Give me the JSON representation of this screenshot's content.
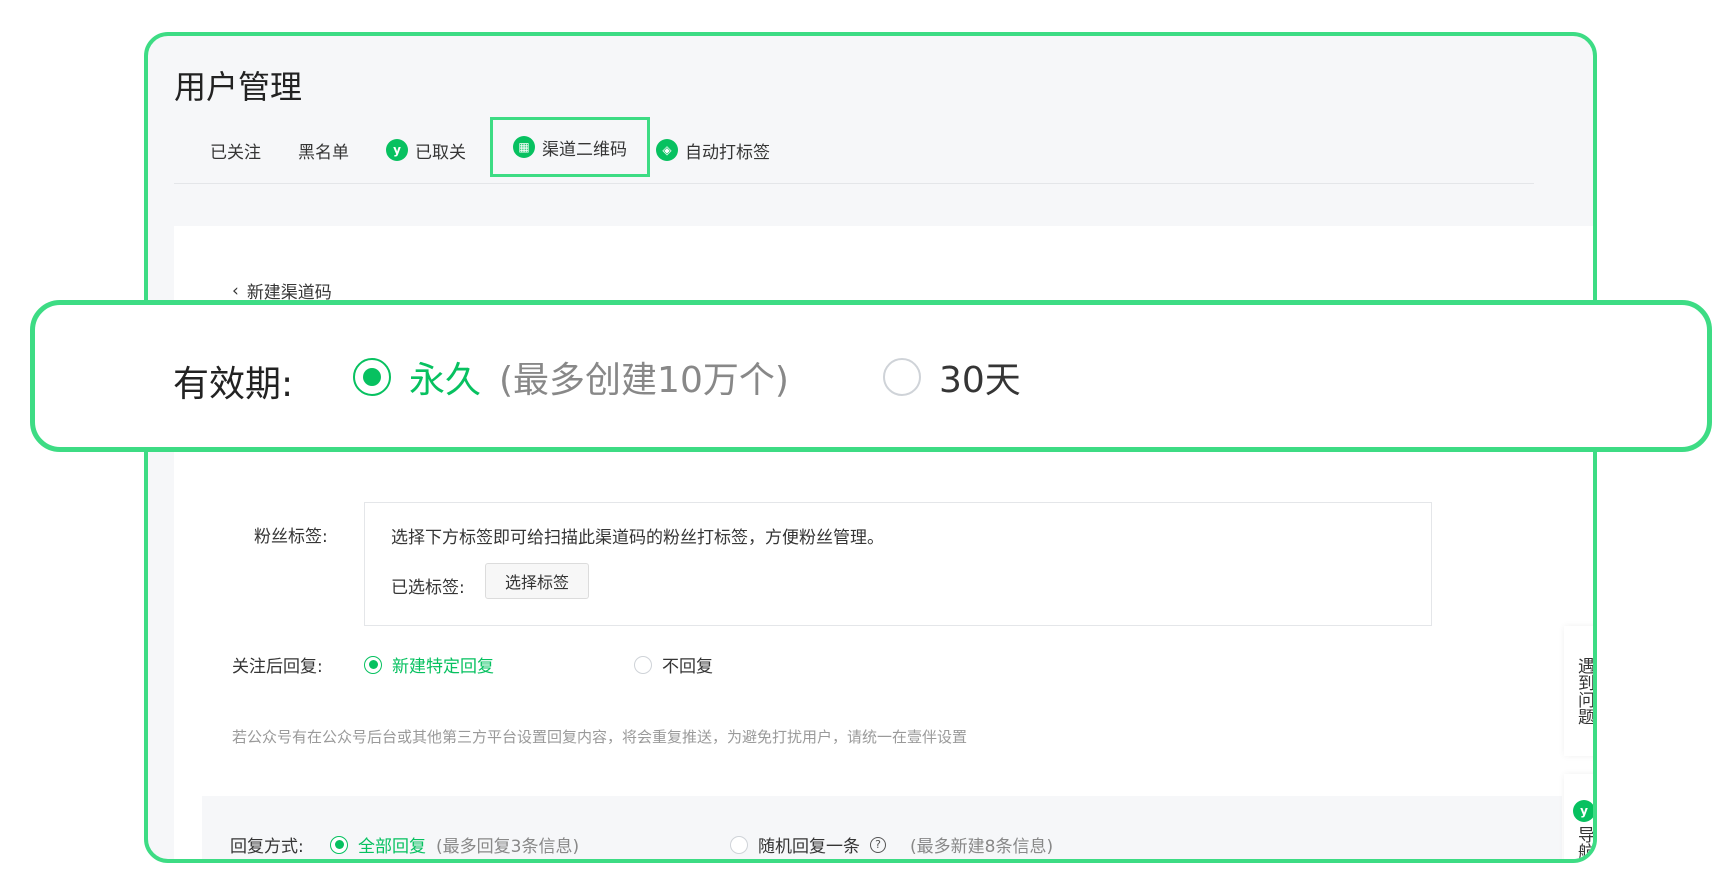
{
  "page": {
    "title": "用户管理"
  },
  "tabs": [
    {
      "label": "已关注"
    },
    {
      "label": "黑名单"
    },
    {
      "label": "已取关"
    },
    {
      "label": "渠道二维码"
    },
    {
      "label": "自动打标签"
    }
  ],
  "back": {
    "label": "新建渠道码"
  },
  "validity": {
    "label": "有效期:",
    "options": [
      {
        "label": "永久",
        "note": "(最多创建10万个)",
        "selected": true
      },
      {
        "label": "30天",
        "selected": false
      }
    ]
  },
  "fan_tags": {
    "label": "粉丝标签:",
    "hint": "选择下方标签即可给扫描此渠道码的粉丝打标签，方便粉丝管理。",
    "selected_label": "已选标签:",
    "select_button": "选择标签"
  },
  "follow_reply": {
    "label": "关注后回复:",
    "options": [
      {
        "label": "新建特定回复",
        "selected": true
      },
      {
        "label": "不回复",
        "selected": false
      }
    ],
    "note": "若公众号有在公众号后台或其他第三方平台设置回复内容，将会重复推送，为避免打扰用户，请统一在壹伴设置"
  },
  "reply_mode": {
    "label": "回复方式:",
    "options": [
      {
        "label": "全部回复",
        "note": "(最多回复3条信息)",
        "selected": true
      },
      {
        "label": "随机回复一条",
        "note": "(最多新建8条信息)",
        "selected": false
      }
    ]
  },
  "float": {
    "help": "遇到问题",
    "nav": "导航"
  },
  "colors": {
    "accent": "#07c160",
    "highlight": "#3ddc84"
  }
}
